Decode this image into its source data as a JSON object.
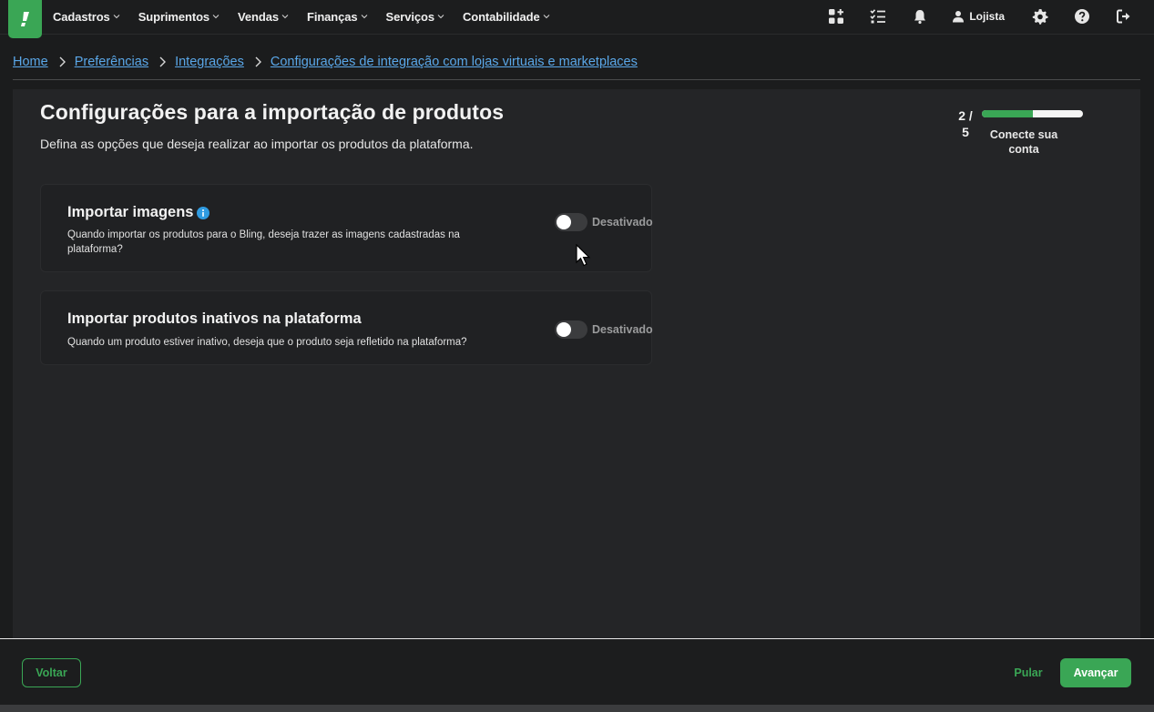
{
  "nav": {
    "menu": [
      {
        "label": "Cadastros"
      },
      {
        "label": "Suprimentos"
      },
      {
        "label": "Vendas"
      },
      {
        "label": "Finanças"
      },
      {
        "label": "Serviços"
      },
      {
        "label": "Contabilidade"
      }
    ],
    "user_label": "Lojista",
    "icons": [
      "apps-add-icon",
      "checklist-icon",
      "bell-icon",
      "user-icon",
      "gear-icon",
      "help-icon",
      "logout-icon"
    ]
  },
  "breadcrumb": [
    {
      "label": "Home"
    },
    {
      "label": "Preferências"
    },
    {
      "label": "Integrações"
    },
    {
      "label": "Configurações de integração com lojas virtuais e marketplaces"
    }
  ],
  "page": {
    "title": "Configurações para a importação de produtos",
    "description": "Defina as opções que deseja realizar ao importar os produtos da plataforma."
  },
  "progress": {
    "current": "2 /",
    "total": "5",
    "fraction": 0.5,
    "label": "Conecte sua conta"
  },
  "settings": [
    {
      "title": "Importar imagens",
      "description": "Quando importar os produtos para o Bling, deseja trazer as imagens cadastradas na plataforma?",
      "toggle_label": "Desativado",
      "enabled": false
    },
    {
      "title": "Importar produtos inativos na plataforma",
      "description": "Quando um produto estiver inativo, deseja que o produto seja refletido na plataforma?",
      "toggle_label": "Desativado",
      "enabled": false
    }
  ],
  "footer": {
    "back_label": "Voltar",
    "skip_label": "Pular",
    "next_label": "Avançar"
  },
  "colors": {
    "accent": "#3aa655",
    "link": "#5aa7e8",
    "info": "#2f9be0",
    "background": "#1b1c1d",
    "panel": "#242527"
  }
}
